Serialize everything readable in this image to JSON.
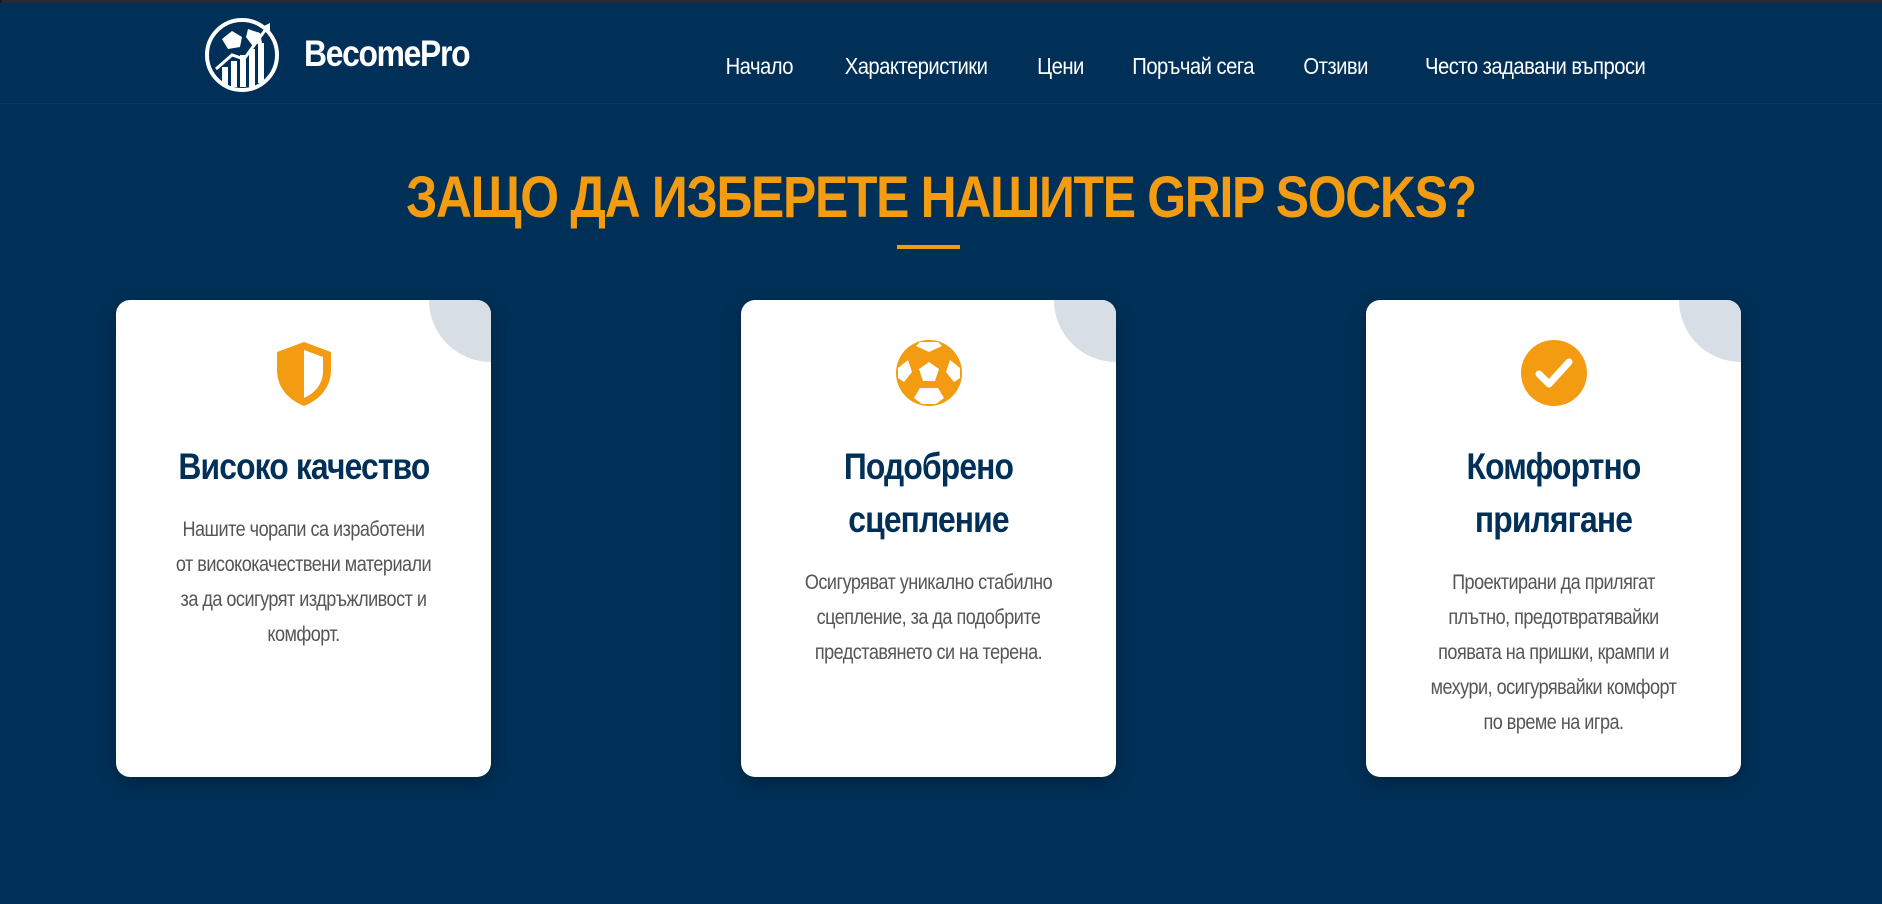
{
  "header": {
    "brand": "BecomePro",
    "nav": [
      {
        "label": "Начало"
      },
      {
        "label": "Характеристики"
      },
      {
        "label": "Цени"
      },
      {
        "label": "Поръчай сега"
      },
      {
        "label": "Отзиви"
      },
      {
        "label": "Често задавани въпроси"
      }
    ]
  },
  "section": {
    "title": "ЗАЩО ДА ИЗБЕРЕТЕ НАШИТЕ GRIP SOCKS?"
  },
  "features": [
    {
      "icon": "shield-icon",
      "title": "Високо качество",
      "text": "Нашите чорапи са изработени от висококачествени материали за да осигурят издръжливост и комфорт."
    },
    {
      "icon": "soccer-ball-icon",
      "title": "Подобрено сцепление",
      "text": "Осигуряват уникално стабилно сцепление, за да подобрите представянето си на терена."
    },
    {
      "icon": "check-circle-icon",
      "title": "Комфортно прилягане",
      "text": "Проектирани да прилягат плътно, предотвратявайки появата на пришки, крампи и мехури, осигурявайки комфорт по време на игра."
    }
  ],
  "colors": {
    "background": "#003057",
    "accent": "#f39c12",
    "card": "#ffffff",
    "card_title": "#003057",
    "card_text": "#555555"
  }
}
